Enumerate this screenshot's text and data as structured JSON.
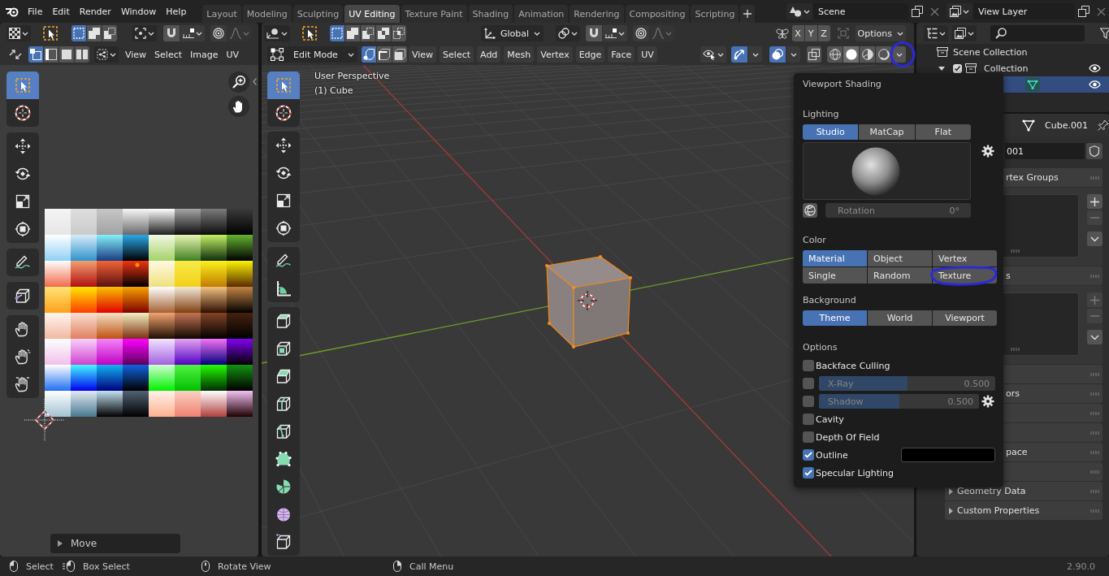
{
  "top_bar": {
    "menus": [
      "File",
      "Edit",
      "Render",
      "Window",
      "Help"
    ],
    "workspaces": [
      {
        "label": "Layout",
        "selected": false
      },
      {
        "label": "Modeling",
        "selected": false
      },
      {
        "label": "Sculpting",
        "selected": false
      },
      {
        "label": "UV Editing",
        "selected": true
      },
      {
        "label": "Texture Paint",
        "selected": false
      },
      {
        "label": "Shading",
        "selected": false
      },
      {
        "label": "Animation",
        "selected": false
      },
      {
        "label": "Rendering",
        "selected": false
      },
      {
        "label": "Compositing",
        "selected": false
      },
      {
        "label": "Scripting",
        "selected": false
      }
    ],
    "scene": "Scene",
    "view_layer": "View Layer"
  },
  "uv_editor": {
    "select_modes": [
      {
        "kind": "set",
        "selected": true
      },
      {
        "kind": "extend",
        "selected": false
      },
      {
        "kind": "subtract",
        "selected": false
      }
    ],
    "snap_on": false,
    "proportional_on": false,
    "uv_select_modes": [
      {
        "kind": "vertex",
        "selected": true
      },
      {
        "kind": "edge",
        "selected": false
      },
      {
        "kind": "face",
        "selected": false
      },
      {
        "kind": "island",
        "selected": false
      }
    ],
    "menus": [
      "View",
      "Select",
      "Image",
      "UV"
    ],
    "tool_groups": [
      [
        {
          "kind": "select_box",
          "selected": true
        },
        {
          "kind": "cursor",
          "selected": false
        }
      ],
      [
        {
          "kind": "move",
          "selected": false
        },
        {
          "kind": "rotate",
          "selected": false
        },
        {
          "kind": "scale",
          "selected": false
        },
        {
          "kind": "transform",
          "selected": false
        }
      ],
      [
        {
          "kind": "annotate",
          "selected": false
        }
      ],
      [
        {
          "kind": "rip",
          "selected": false
        }
      ],
      [
        {
          "kind": "grab",
          "selected": false
        },
        {
          "kind": "pinch",
          "selected": false
        },
        {
          "kind": "relax",
          "selected": false
        }
      ]
    ],
    "last_operation": "Move"
  },
  "viewport": {
    "select_modes": [
      {
        "kind": "set",
        "selected": true
      },
      {
        "kind": "extend",
        "selected": false
      },
      {
        "kind": "subtract",
        "selected": false
      },
      {
        "kind": "difference",
        "selected": false
      },
      {
        "kind": "intersect",
        "selected": false
      }
    ],
    "orientation": "Global",
    "snap_on": false,
    "proportional_on": false,
    "mirror_axes": [
      {
        "label": "X",
        "selected": false
      },
      {
        "label": "Y",
        "selected": false
      },
      {
        "label": "Z",
        "selected": false
      }
    ],
    "options": "Options",
    "mode": "Edit Mode",
    "mesh_select_modes": [
      {
        "kind": "vertex",
        "selected": true
      },
      {
        "kind": "edge",
        "selected": false
      },
      {
        "kind": "face",
        "selected": false
      }
    ],
    "menus": [
      "View",
      "Select",
      "Add",
      "Mesh",
      "Vertex",
      "Edge",
      "Face",
      "UV"
    ],
    "gizmos_on": true,
    "overlays_on": true,
    "xray_on": false,
    "shading_modes": [
      {
        "kind": "wireframe",
        "selected": false
      },
      {
        "kind": "solid",
        "selected": true
      },
      {
        "kind": "material",
        "selected": false
      },
      {
        "kind": "rendered",
        "selected": false
      }
    ],
    "view_name": "User Perspective",
    "object_info": "(1) Cube",
    "tool_groups": [
      [
        {
          "kind": "select_box",
          "selected": true
        },
        {
          "kind": "cursor",
          "selected": false
        }
      ],
      [
        {
          "kind": "move",
          "selected": false
        },
        {
          "kind": "rotate",
          "selected": false
        },
        {
          "kind": "scale",
          "selected": false
        },
        {
          "kind": "transform",
          "selected": false
        }
      ],
      [
        {
          "kind": "annotate",
          "selected": false
        },
        {
          "kind": "measure",
          "selected": false
        }
      ],
      [
        {
          "kind": "extrude",
          "selected": false
        },
        {
          "kind": "inset",
          "selected": false
        },
        {
          "kind": "bevel",
          "selected": false
        },
        {
          "kind": "loop_cut",
          "selected": false
        },
        {
          "kind": "knife",
          "selected": false
        },
        {
          "kind": "poly_build",
          "selected": false
        },
        {
          "kind": "spin",
          "selected": false
        },
        {
          "kind": "smooth",
          "selected": false
        },
        {
          "kind": "shrink",
          "selected": false
        }
      ]
    ]
  },
  "shading_popover": {
    "title": "Viewport Shading",
    "lighting": {
      "label": "Lighting",
      "options": [
        {
          "label": "Studio",
          "selected": true
        },
        {
          "label": "MatCap",
          "selected": false
        },
        {
          "label": "Flat",
          "selected": false
        }
      ],
      "rotation_label": "Rotation",
      "rotation_value": "0°",
      "rotation_disabled": true
    },
    "color": {
      "label": "Color",
      "options": [
        {
          "label": "Material",
          "selected": true
        },
        {
          "label": "Object",
          "selected": false
        },
        {
          "label": "Vertex",
          "selected": false
        },
        {
          "label": "Single",
          "selected": false
        },
        {
          "label": "Random",
          "selected": false
        },
        {
          "label": "Texture",
          "selected": false
        }
      ]
    },
    "background": {
      "label": "Background",
      "options": [
        {
          "label": "Theme",
          "selected": true
        },
        {
          "label": "World",
          "selected": false
        },
        {
          "label": "Viewport",
          "selected": false
        }
      ]
    },
    "options": {
      "label": "Options",
      "items": [
        {
          "kind": "checkbox",
          "label": "Backface Culling",
          "checked": false
        },
        {
          "kind": "slider",
          "label": "X-Ray",
          "checked": false,
          "level": 0.5,
          "reading": "0.500"
        },
        {
          "kind": "slider",
          "label": "Shadow",
          "checked": false,
          "level": 0.5,
          "reading": "0.500",
          "settings": true
        },
        {
          "kind": "checkbox",
          "label": "Cavity",
          "checked": false
        },
        {
          "kind": "checkbox",
          "label": "Depth Of Field",
          "checked": false
        },
        {
          "kind": "color",
          "label": "Outline",
          "checked": true,
          "color": "#000000"
        },
        {
          "kind": "checkbox",
          "label": "Specular Lighting",
          "checked": true
        }
      ]
    }
  },
  "outliner": {
    "rows": [
      {
        "kind": "scene_collection",
        "label": "Scene Collection",
        "selected": false,
        "children": [
          {
            "kind": "collection",
            "label": "Collection",
            "selected": false,
            "expanded": true,
            "checked": true,
            "children": [
              {
                "kind": "mesh_object",
                "selected": true
              }
            ]
          }
        ]
      }
    ]
  },
  "properties": {
    "data_name": "Cube.001",
    "name_value": "001",
    "panels": [
      {
        "kind": "list",
        "label": "rtex Groups",
        "under_popover": true,
        "buttons": [
          {
            "kind": "add",
            "disabled": false
          },
          {
            "kind": "remove",
            "disabled": true
          },
          {
            "kind": "menu",
            "disabled": false
          }
        ]
      },
      {
        "kind": "list",
        "label": "s",
        "under_popover": true,
        "buttons": [
          {
            "kind": "add",
            "disabled": true
          },
          {
            "kind": "remove",
            "disabled": true
          },
          {
            "kind": "menu",
            "disabled": false
          }
        ]
      },
      {
        "kind": "header"
      },
      {
        "kind": "header",
        "label": "ors",
        "under_popover": true
      },
      {
        "kind": "header"
      },
      {
        "kind": "header"
      },
      {
        "kind": "header",
        "label": "pace",
        "under_popover": true
      },
      {
        "kind": "header"
      },
      {
        "kind": "header",
        "label": "Geometry Data",
        "under_popover": false,
        "expanded": false
      },
      {
        "kind": "header",
        "label": "Custom Properties",
        "under_popover": false,
        "expanded": false
      }
    ]
  },
  "status_bar": {
    "hints": [
      {
        "kind": "left_click",
        "label": "Select"
      },
      {
        "kind": "drag",
        "label": "Box Select"
      },
      {
        "kind": "middle_click",
        "label": "Rotate View"
      },
      {
        "kind": "right_click",
        "label": "Call Menu"
      }
    ],
    "version": "2.90.0"
  }
}
